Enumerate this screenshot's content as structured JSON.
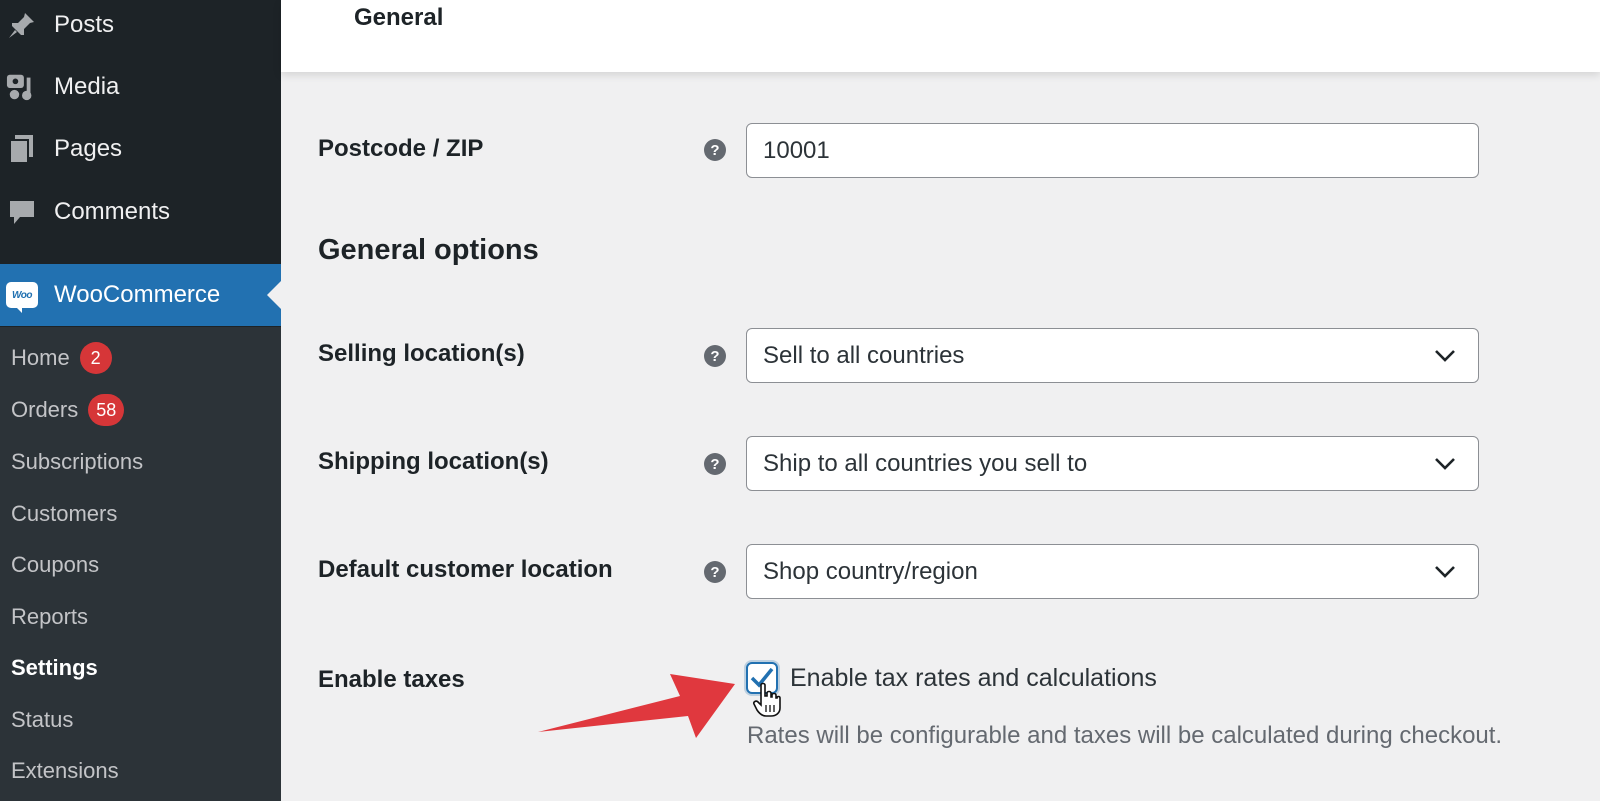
{
  "sidebar": {
    "top_items": [
      {
        "label": "Posts",
        "icon": "pin-icon"
      },
      {
        "label": "Media",
        "icon": "media-icon"
      },
      {
        "label": "Pages",
        "icon": "pages-icon"
      },
      {
        "label": "Comments",
        "icon": "comment-icon"
      }
    ],
    "woocommerce": {
      "label": "WooCommerce",
      "logo_text": "Woo"
    },
    "submenu": [
      {
        "label": "Home",
        "badge": "2"
      },
      {
        "label": "Orders",
        "badge": "58"
      },
      {
        "label": "Subscriptions"
      },
      {
        "label": "Customers"
      },
      {
        "label": "Coupons"
      },
      {
        "label": "Reports"
      },
      {
        "label": "Settings",
        "current": true
      },
      {
        "label": "Status"
      },
      {
        "label": "Extensions"
      }
    ]
  },
  "header": {
    "tab": "General"
  },
  "form": {
    "postcode": {
      "label": "Postcode / ZIP",
      "value": "10001"
    },
    "section_title": "General options",
    "selling": {
      "label": "Selling location(s)",
      "value": "Sell to all countries"
    },
    "shipping": {
      "label": "Shipping location(s)",
      "value": "Ship to all countries you sell to"
    },
    "default_location": {
      "label": "Default customer location",
      "value": "Shop country/region"
    },
    "taxes": {
      "label": "Enable taxes",
      "checkbox_label": "Enable tax rates and calculations",
      "checked": true,
      "description": "Rates will be configurable and taxes will be calculated during checkout."
    },
    "help_glyph": "?"
  },
  "colors": {
    "accent": "#2271b1",
    "badge": "#d63638",
    "annotation_arrow": "#e0383e",
    "sidebar_bg": "#1d2327"
  }
}
